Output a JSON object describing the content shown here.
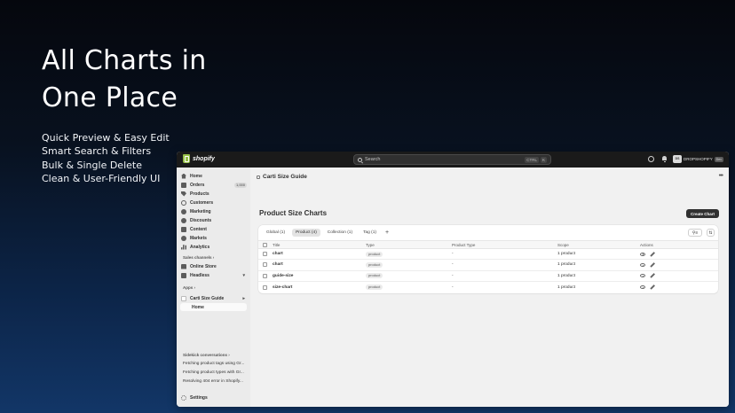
{
  "hero": {
    "title_line1": "All Charts in",
    "title_line2": "One Place",
    "features": [
      "Quick Preview & Easy Edit",
      "Smart Search & Filters",
      "Bulk & Single Delete",
      "Clean & User-Friendly UI"
    ]
  },
  "topbar": {
    "brand": "shopify",
    "search_placeholder": "Search",
    "shortcut_ctrl": "CTRL",
    "shortcut_key": "K",
    "store_initials": "DS",
    "store_name": "DROPSHOPIFY",
    "store_badge": "Dev",
    "icons": [
      "globe-icon",
      "bell-icon"
    ]
  },
  "sidebar": {
    "items": [
      {
        "label": "Home",
        "icon": "home-icon"
      },
      {
        "label": "Orders",
        "icon": "inbox-icon",
        "badge": "1,000"
      },
      {
        "label": "Products",
        "icon": "tag-icon"
      },
      {
        "label": "Customers",
        "icon": "person-icon"
      },
      {
        "label": "Marketing",
        "icon": "target-icon"
      },
      {
        "label": "Discounts",
        "icon": "discount-icon"
      },
      {
        "label": "Content",
        "icon": "content-icon"
      },
      {
        "label": "Markets",
        "icon": "globe-icon"
      },
      {
        "label": "Analytics",
        "icon": "chart-icon"
      }
    ],
    "sales_channels_label": "Sales channels",
    "sales_channels": [
      {
        "label": "Online Store",
        "icon": "store-icon"
      },
      {
        "label": "Headless",
        "icon": "headless-icon"
      }
    ],
    "apps_label": "Apps",
    "app": {
      "label": "Carti Size Guide",
      "icon": "app-icon"
    },
    "app_sub": "Home",
    "conversations_label": "Sidekick conversations",
    "conversations": [
      "Fetching product tags using Gr...",
      "Fetching product types with Gr...",
      "Resolving 404 error in Shopify..."
    ],
    "settings_label": "Settings"
  },
  "main": {
    "breadcrumb": "Carti Size Guide",
    "page_title": "Product Size Charts",
    "create_button": "Create Chart",
    "tabs": [
      {
        "label": "Global (1)",
        "active": false
      },
      {
        "label": "Product (4)",
        "active": true
      },
      {
        "label": "Collection (1)",
        "active": false
      },
      {
        "label": "Tag (1)",
        "active": false
      }
    ],
    "add_tab": "+",
    "columns": [
      "Title",
      "Type",
      "Product Type",
      "Scope",
      "Actions"
    ],
    "rows": [
      {
        "title": "chart",
        "type": "product",
        "product_type": "-",
        "scope": "1 product"
      },
      {
        "title": "chart",
        "type": "product",
        "product_type": "-",
        "scope": "1 product"
      },
      {
        "title": "guide-size",
        "type": "product",
        "product_type": "-",
        "scope": "1 product"
      },
      {
        "title": "size-chart",
        "type": "product",
        "product_type": "-",
        "scope": "1 product"
      }
    ]
  }
}
